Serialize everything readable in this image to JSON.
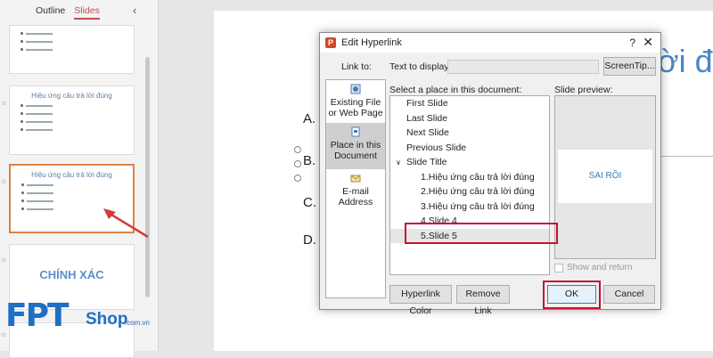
{
  "pane": {
    "tabs": [
      "Outline",
      "Slides"
    ],
    "active_tab": "Slides",
    "collapse_icon": "chevron-left-icon"
  },
  "thumbnails": [
    {
      "title": ""
    },
    {
      "title": "Hiệu ứng câu trả lời đúng"
    },
    {
      "title": "Hiệu ứng câu trả lời đúng"
    },
    {
      "title": "CHÍNH XÁC"
    }
  ],
  "logo": {
    "fpt": "FPT",
    "shop": "Shop",
    "domain": ".com.vn"
  },
  "slide": {
    "title_fragment": "ời đ",
    "answers": [
      "A.",
      "B.",
      "C.",
      "D."
    ]
  },
  "dialog": {
    "title": "Edit Hyperlink",
    "help": "?",
    "close": "✕",
    "link_to_label": "Link to:",
    "text_to_display_label": "Text to display:",
    "text_to_display_value": "",
    "screentip_button": "ScreenTip...",
    "link_options": [
      {
        "label": "Existing File or Web Page",
        "icon": "web-page-icon"
      },
      {
        "label": "Place in this Document",
        "icon": "document-place-icon",
        "selected": true
      },
      {
        "label": "E-mail Address",
        "icon": "email-icon"
      }
    ],
    "places_label": "Select a place in this document:",
    "places": {
      "first": "First Slide",
      "last": "Last Slide",
      "next": "Next Slide",
      "previous": "Previous Slide",
      "group": "Slide Title",
      "slides": [
        "1.Hiệu ứng câu trả lời đúng",
        "2.Hiệu ứng câu trả lời đúng",
        "3.Hiệu ứng câu trả lời đúng",
        "4.Slide 4",
        "5.Slide 5"
      ],
      "selected": "5.Slide 5"
    },
    "preview_label": "Slide preview:",
    "preview_text": "SAI RỒI",
    "show_and_return": "Show and return",
    "hyperlink_color_button": "Hyperlink Color",
    "remove_link_button": "Remove Link",
    "ok_button": "OK",
    "cancel_button": "Cancel"
  },
  "colors": {
    "accent": "#c0504d",
    "highlight": "#c8102e",
    "brand": "#1f6fc5",
    "arrow": "#d23b3b"
  }
}
